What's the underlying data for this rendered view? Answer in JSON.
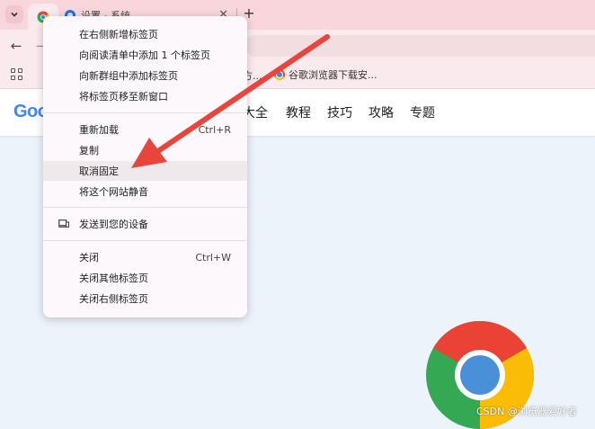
{
  "tabstrip": {
    "search_tabs_icon": "chevron-down-icon",
    "pinned_tab_icon": "chrome-icon",
    "active_tab": {
      "title": "设置 - 系统",
      "close": "✕"
    },
    "new_tab": "+"
  },
  "toolbar": {
    "back": "←",
    "forward": "→"
  },
  "bookmarks": {
    "partial": "方...",
    "item_label": "谷歌浏览器下载安..."
  },
  "site": {
    "logo": "Goo",
    "nav": [
      "大全",
      "教程",
      "技巧",
      "攻略",
      "专题"
    ]
  },
  "context_menu": {
    "items": [
      {
        "label": "在右侧新增标签页"
      },
      {
        "label": "向阅读清单中添加 1 个标签页"
      },
      {
        "label": "向新群组中添加标签页"
      },
      {
        "label": "将标签页移至新窗口"
      },
      {
        "label": "重新加载",
        "shortcut": "Ctrl+R"
      },
      {
        "label": "复制"
      },
      {
        "label": "取消固定"
      },
      {
        "label": "将这个网站静音"
      },
      {
        "label": "发送到您的设备"
      },
      {
        "label": "关闭",
        "shortcut": "Ctrl+W"
      },
      {
        "label": "关闭其他标签页"
      },
      {
        "label": "关闭右侧标签页"
      }
    ],
    "hovered_item": "取消固定"
  },
  "colors": {
    "tabstrip_bg": "#f8d6dc",
    "toolbar_bg": "#fbeaed",
    "menu_bg": "#fcf8fb",
    "arrow": "#e8453c",
    "page_bg": "#edf3fb"
  },
  "watermark": "CSDN @浏览器爱好者"
}
